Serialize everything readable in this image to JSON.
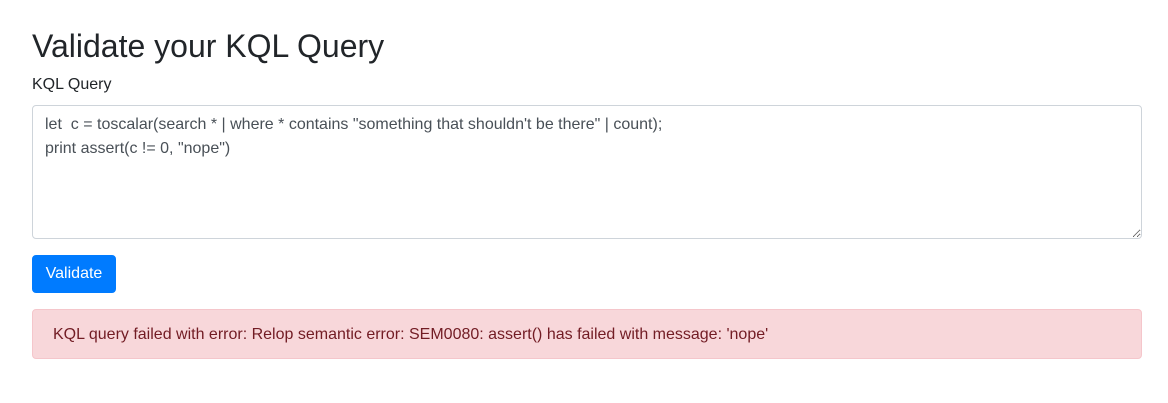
{
  "page": {
    "title": "Validate your KQL Query"
  },
  "form": {
    "query_label": "KQL Query",
    "query_value": "let  c = toscalar(search * | where * contains \"something that shouldn't be there\" | count);\nprint assert(c != 0, \"nope\")",
    "validate_label": "Validate"
  },
  "alert": {
    "message": "KQL query failed with error: Relop semantic error: SEM0080: assert() has failed with message: 'nope'",
    "colors": {
      "background": "#f8d7da",
      "border": "#f5c6cb",
      "text": "#721c24"
    }
  },
  "colors": {
    "accent": "#007bff"
  }
}
